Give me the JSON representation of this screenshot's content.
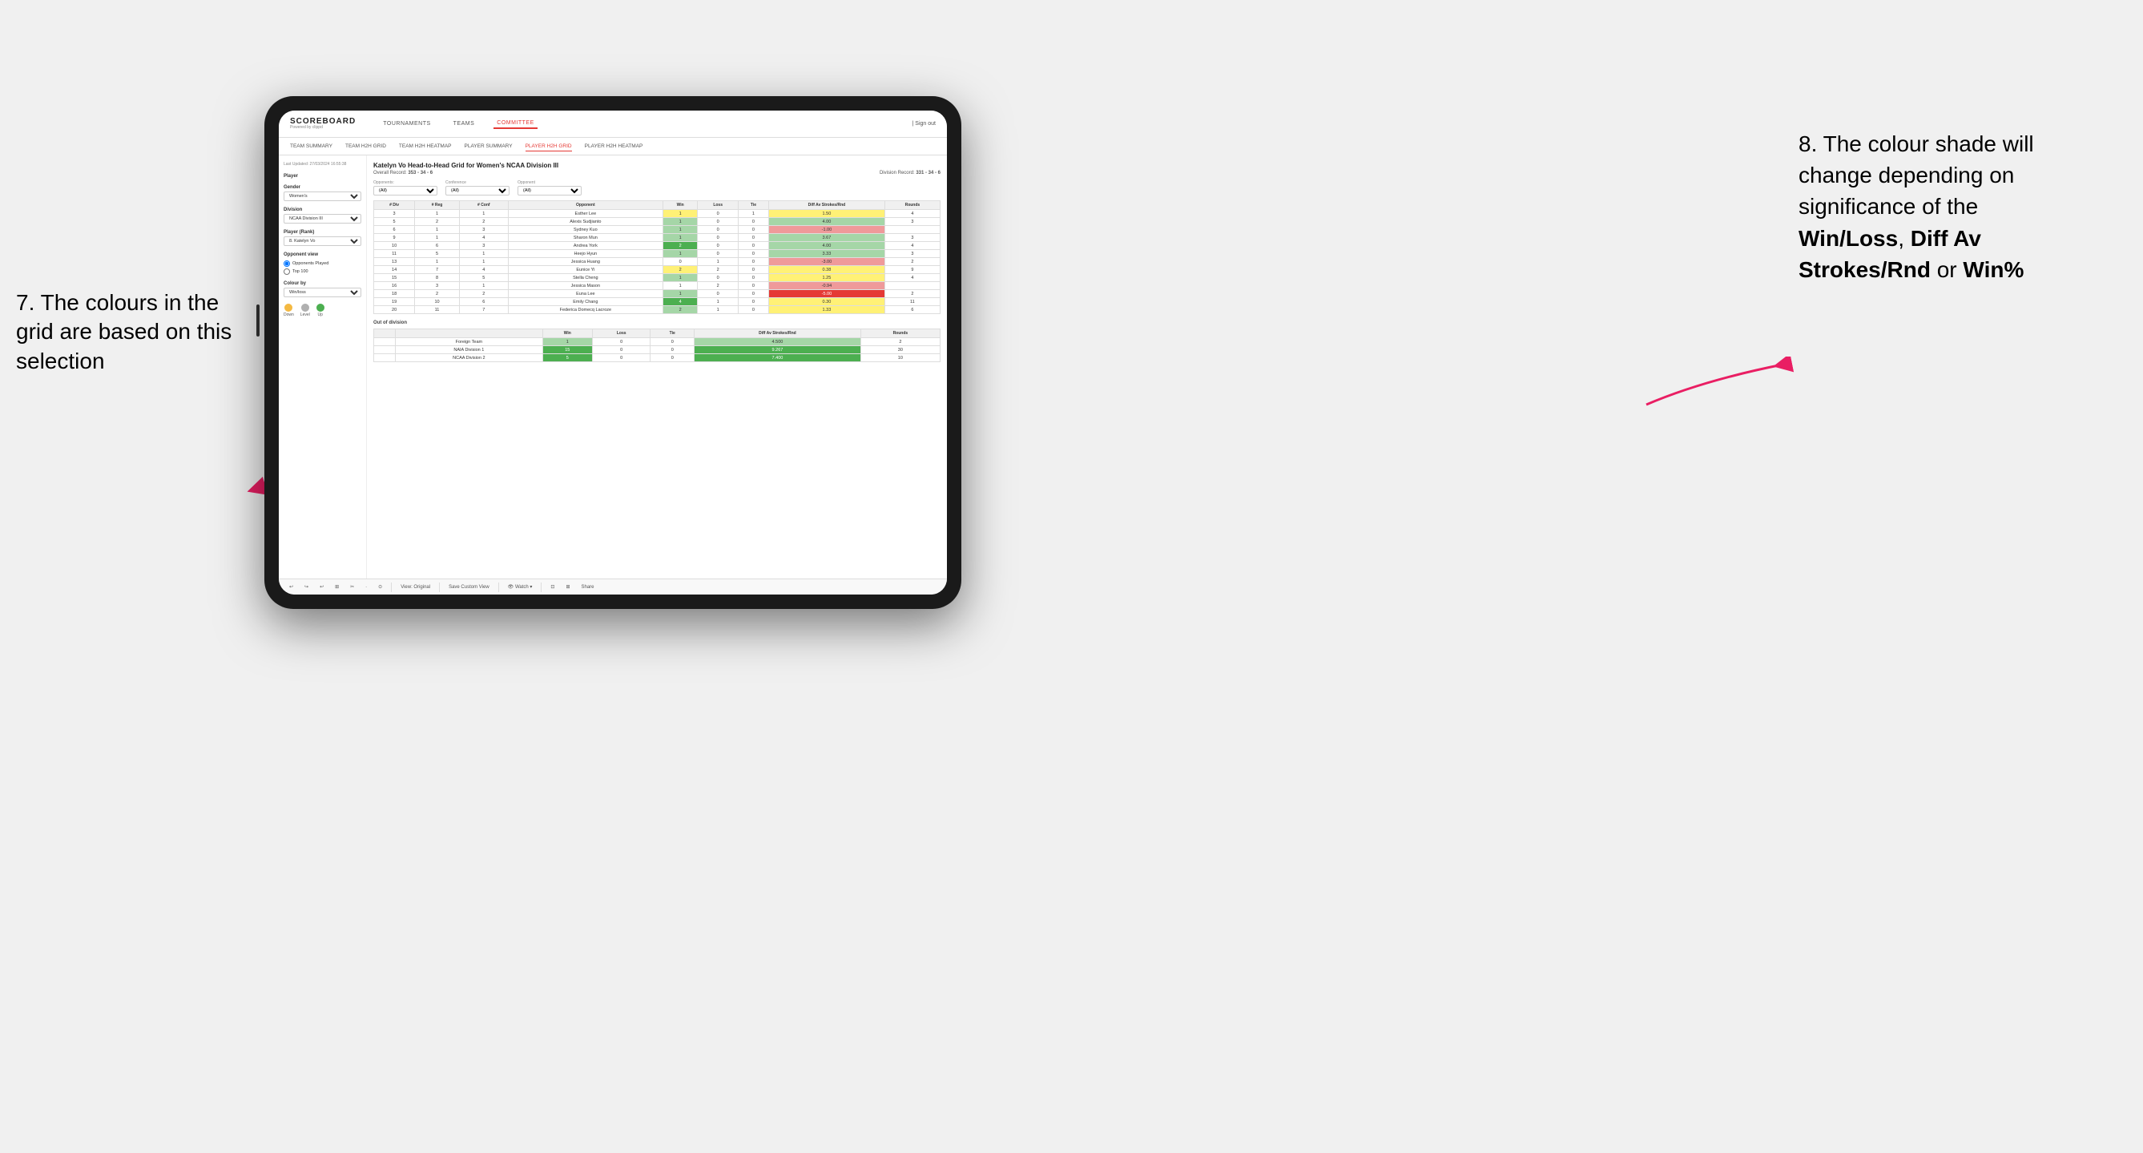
{
  "page": {
    "background": "#f0f0f0"
  },
  "annotation_left": {
    "text": "7. The colours in the grid are based on this selection"
  },
  "annotation_right": {
    "line1": "8. The colour shade will change depending on significance of the",
    "bold1": "Win/Loss",
    "comma1": ", ",
    "bold2": "Diff Av Strokes/Rnd",
    "or": " or ",
    "bold3": "Win%"
  },
  "nav": {
    "logo": "SCOREBOARD",
    "logo_sub": "Powered by clippd",
    "items": [
      "TOURNAMENTS",
      "TEAMS",
      "COMMITTEE"
    ],
    "active": "COMMITTEE",
    "header_right": [
      "| Sign out"
    ]
  },
  "sub_nav": {
    "items": [
      "TEAM SUMMARY",
      "TEAM H2H GRID",
      "TEAM H2H HEATMAP",
      "PLAYER SUMMARY",
      "PLAYER H2H GRID",
      "PLAYER H2H HEATMAP"
    ],
    "active": "PLAYER H2H GRID"
  },
  "sidebar": {
    "timestamp": "Last Updated: 27/03/2024\n16:55:38",
    "player_label": "Player",
    "gender_label": "Gender",
    "gender_value": "Women's",
    "division_label": "Division",
    "division_value": "NCAA Division III",
    "rank_label": "Player (Rank)",
    "rank_value": "8. Katelyn Vo",
    "opponent_view_label": "Opponent view",
    "radio_opponents": "Opponents Played",
    "radio_top100": "Top 100",
    "colour_by_label": "Colour by",
    "colour_by_value": "Win/loss",
    "legend_down": "Down",
    "legend_level": "Level",
    "legend_up": "Up"
  },
  "grid": {
    "title": "Katelyn Vo Head-to-Head Grid for Women's NCAA Division III",
    "overall_record_label": "Overall Record:",
    "overall_record": "353 - 34 - 6",
    "division_record_label": "Division Record:",
    "division_record": "331 - 34 - 6",
    "filter_opponents_label": "Opponents:",
    "filter_opponents_value": "(All)",
    "filter_conference_label": "Conference",
    "filter_conference_value": "(All)",
    "filter_opponent_label": "Opponent",
    "filter_opponent_value": "(All)",
    "col_headers": [
      "# Div",
      "# Reg",
      "# Conf",
      "Opponent",
      "Win",
      "Loss",
      "Tie",
      "Diff Av Strokes/Rnd",
      "Rounds"
    ],
    "rows": [
      {
        "div": "3",
        "reg": "1",
        "conf": "1",
        "opponent": "Esther Lee",
        "win": "1",
        "loss": "0",
        "tie": "1",
        "diff": "1.50",
        "rounds": "4",
        "win_color": "yellow",
        "diff_color": "yellow"
      },
      {
        "div": "5",
        "reg": "2",
        "conf": "2",
        "opponent": "Alexis Sudjianto",
        "win": "1",
        "loss": "0",
        "tie": "0",
        "diff": "4.00",
        "rounds": "3",
        "win_color": "light-green",
        "diff_color": "light-green"
      },
      {
        "div": "6",
        "reg": "1",
        "conf": "3",
        "opponent": "Sydney Kuo",
        "win": "1",
        "loss": "0",
        "tie": "0",
        "diff": "-1.00",
        "rounds": "",
        "win_color": "light-green",
        "diff_color": "loss-light"
      },
      {
        "div": "9",
        "reg": "1",
        "conf": "4",
        "opponent": "Sharon Mun",
        "win": "1",
        "loss": "0",
        "tie": "0",
        "diff": "3.67",
        "rounds": "3",
        "win_color": "light-green",
        "diff_color": "light-green"
      },
      {
        "div": "10",
        "reg": "6",
        "conf": "3",
        "opponent": "Andrea York",
        "win": "2",
        "loss": "0",
        "tie": "0",
        "diff": "4.00",
        "rounds": "4",
        "win_color": "dark-green",
        "diff_color": "light-green"
      },
      {
        "div": "11",
        "reg": "5",
        "conf": "1",
        "opponent": "Heejo Hyun",
        "win": "1",
        "loss": "0",
        "tie": "0",
        "diff": "3.33",
        "rounds": "3",
        "win_color": "light-green",
        "diff_color": "light-green"
      },
      {
        "div": "13",
        "reg": "1",
        "conf": "1",
        "opponent": "Jessica Huang",
        "win": "0",
        "loss": "1",
        "tie": "0",
        "diff": "-3.00",
        "rounds": "2",
        "win_color": "neutral",
        "diff_color": "loss-light"
      },
      {
        "div": "14",
        "reg": "7",
        "conf": "4",
        "opponent": "Eunice Yi",
        "win": "2",
        "loss": "2",
        "tie": "0",
        "diff": "0.38",
        "rounds": "9",
        "win_color": "yellow",
        "diff_color": "yellow"
      },
      {
        "div": "15",
        "reg": "8",
        "conf": "5",
        "opponent": "Stella Cheng",
        "win": "1",
        "loss": "0",
        "tie": "0",
        "diff": "1.25",
        "rounds": "4",
        "win_color": "light-green",
        "diff_color": "yellow"
      },
      {
        "div": "16",
        "reg": "3",
        "conf": "1",
        "opponent": "Jessica Mason",
        "win": "1",
        "loss": "2",
        "tie": "0",
        "diff": "-0.94",
        "rounds": "",
        "win_color": "neutral",
        "diff_color": "loss-light"
      },
      {
        "div": "18",
        "reg": "2",
        "conf": "2",
        "opponent": "Euna Lee",
        "win": "1",
        "loss": "0",
        "tie": "0",
        "diff": "-5.00",
        "rounds": "2",
        "win_color": "light-green",
        "diff_color": "loss-dark"
      },
      {
        "div": "19",
        "reg": "10",
        "conf": "6",
        "opponent": "Emily Chang",
        "win": "4",
        "loss": "1",
        "tie": "0",
        "diff": "0.30",
        "rounds": "11",
        "win_color": "dark-green",
        "diff_color": "yellow"
      },
      {
        "div": "20",
        "reg": "11",
        "conf": "7",
        "opponent": "Federica Domecq Lacroze",
        "win": "2",
        "loss": "1",
        "tie": "0",
        "diff": "1.33",
        "rounds": "6",
        "win_color": "light-green",
        "diff_color": "yellow"
      }
    ],
    "out_of_division_label": "Out of division",
    "out_rows": [
      {
        "opponent": "Foreign Team",
        "win": "1",
        "loss": "0",
        "tie": "0",
        "diff": "4.500",
        "rounds": "2",
        "win_color": "light-green",
        "diff_color": "light-green"
      },
      {
        "opponent": "NAIA Division 1",
        "win": "15",
        "loss": "0",
        "tie": "0",
        "diff": "9.267",
        "rounds": "30",
        "win_color": "dark-green",
        "diff_color": "dark-green"
      },
      {
        "opponent": "NCAA Division 2",
        "win": "5",
        "loss": "0",
        "tie": "0",
        "diff": "7.400",
        "rounds": "10",
        "win_color": "dark-green",
        "diff_color": "dark-green"
      }
    ]
  },
  "toolbar": {
    "buttons": [
      "↩",
      "↪",
      "↩",
      "⊞",
      "✂",
      "·",
      "⊙",
      "|",
      "View: Original",
      "|",
      "Save Custom View",
      "|",
      "👁 Watch ▾",
      "|",
      "⊡",
      "⊞",
      "Share"
    ]
  }
}
